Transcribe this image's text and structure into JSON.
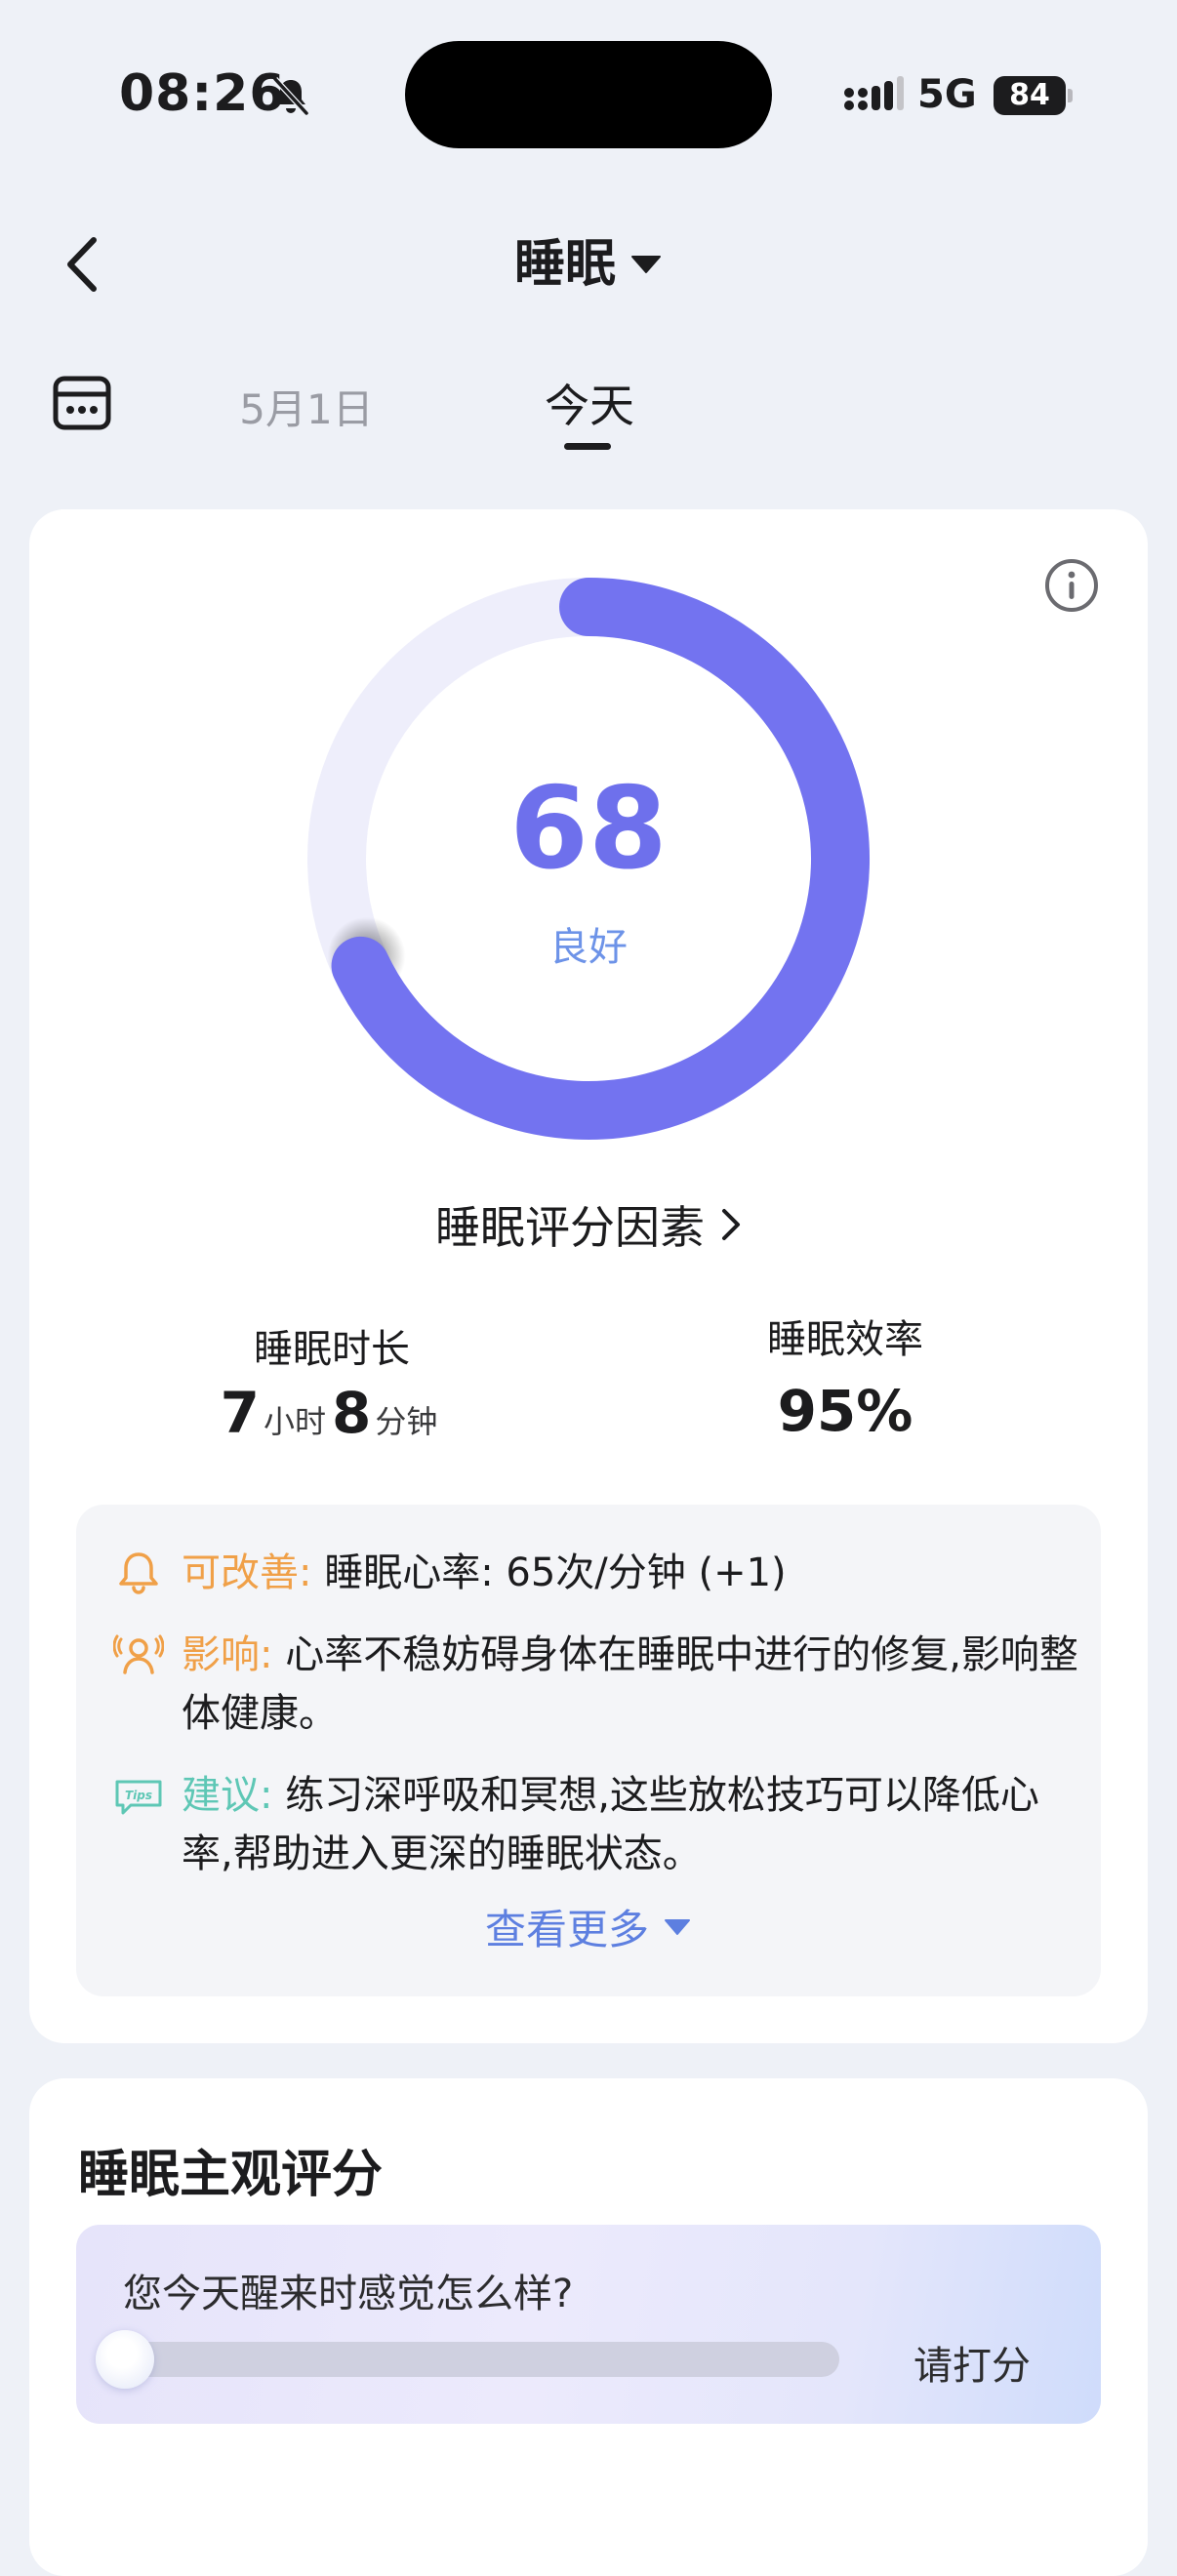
{
  "status_bar": {
    "time": "08:26",
    "network": "5G",
    "battery": "84"
  },
  "nav": {
    "title": "睡眠"
  },
  "date_tabs": [
    {
      "label": "5月1日"
    },
    {
      "label": "今天"
    }
  ],
  "score": {
    "value": "68",
    "label": "良好",
    "fraction": 0.68
  },
  "factors_link": "睡眠评分因素",
  "metrics": {
    "duration": {
      "label": "睡眠时长",
      "hours": "7",
      "hours_unit": "小时",
      "minutes": "8",
      "minutes_unit": "分钟"
    },
    "efficiency": {
      "label": "睡眠效率",
      "value": "95%"
    }
  },
  "advice": {
    "improve": {
      "key": "可改善:",
      "text": "睡眠心率: 65次/分钟 (+1)"
    },
    "impact": {
      "key": "影响:",
      "text": "心率不稳妨碍身体在睡眠中进行的修复,影响整体健康。"
    },
    "suggestion": {
      "key": "建议:",
      "text": "练习深呼吸和冥想,这些放松技巧可以降低心率,帮助进入更深的睡眠状态。"
    },
    "more": "查看更多"
  },
  "subjective": {
    "title": "睡眠主观评分",
    "question": "您今天醒来时感觉怎么样?",
    "rate_button": "请打分"
  },
  "colors": {
    "accent": "#7373f0",
    "ring_track": "#eeeefb",
    "improve": "#f0a048",
    "impact": "#f0a048",
    "suggestion": "#5ec7b5",
    "link": "#5d7fe0"
  }
}
